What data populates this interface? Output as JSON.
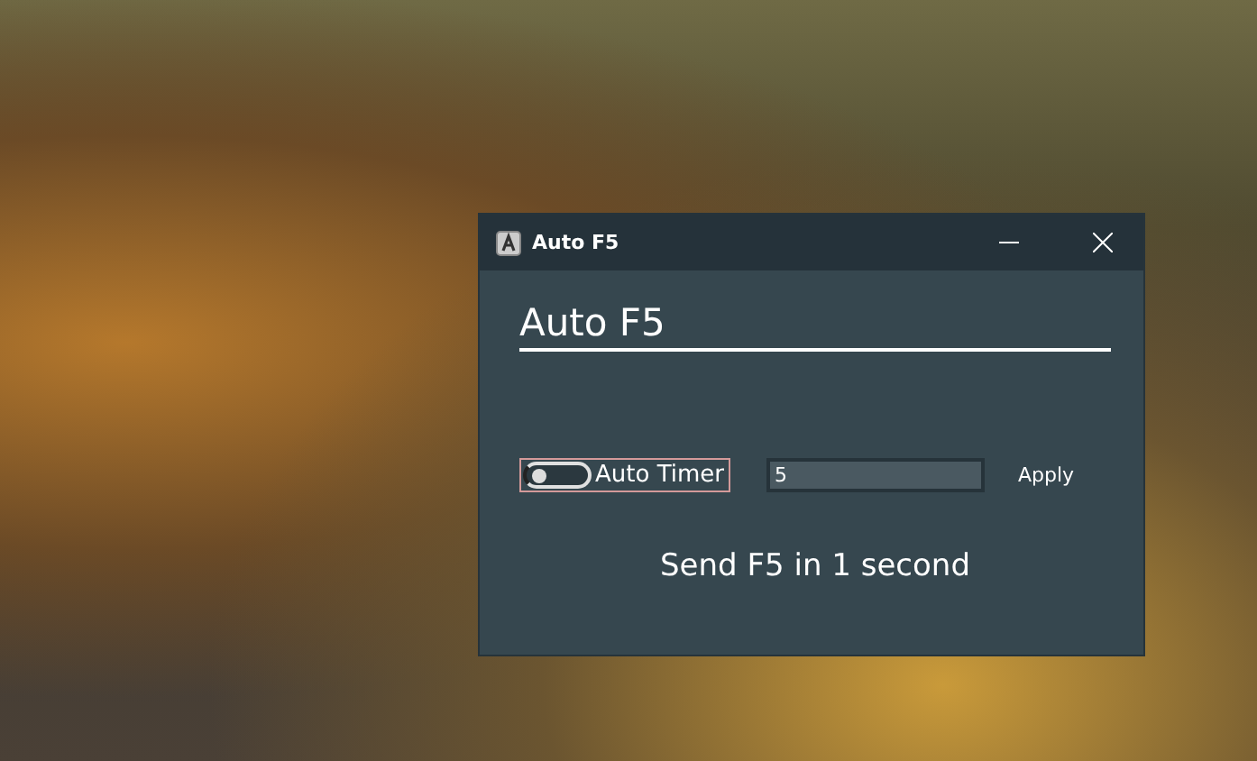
{
  "window": {
    "title": "Auto F5"
  },
  "heading": "Auto F5",
  "auto_timer": {
    "label": "Auto Timer",
    "on": false
  },
  "interval_field": {
    "value": "5"
  },
  "apply_button": "Apply",
  "status": "Send F5 in 1 second"
}
